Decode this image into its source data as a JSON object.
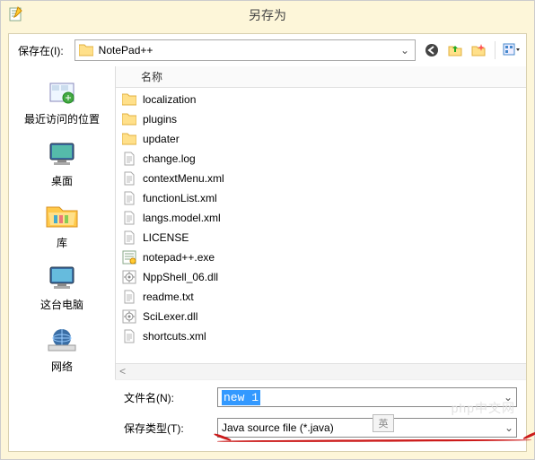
{
  "title": "另存为",
  "location": {
    "label": "保存在(I):",
    "value": "NotePad++"
  },
  "places": [
    {
      "id": "recent",
      "label": "最近访问的位置"
    },
    {
      "id": "desktop",
      "label": "桌面"
    },
    {
      "id": "libraries",
      "label": "库"
    },
    {
      "id": "thispc",
      "label": "这台电脑"
    },
    {
      "id": "network",
      "label": "网络"
    }
  ],
  "fileHeader": "名称",
  "files": [
    {
      "type": "folder",
      "name": "localization"
    },
    {
      "type": "folder",
      "name": "plugins"
    },
    {
      "type": "folder",
      "name": "updater"
    },
    {
      "type": "file",
      "name": "change.log"
    },
    {
      "type": "file",
      "name": "contextMenu.xml"
    },
    {
      "type": "file",
      "name": "functionList.xml"
    },
    {
      "type": "file",
      "name": "langs.model.xml"
    },
    {
      "type": "file",
      "name": "LICENSE"
    },
    {
      "type": "exe",
      "name": "notepad++.exe"
    },
    {
      "type": "dll",
      "name": "NppShell_06.dll"
    },
    {
      "type": "file",
      "name": "readme.txt"
    },
    {
      "type": "dll",
      "name": "SciLexer.dll"
    },
    {
      "type": "file",
      "name": "shortcuts.xml"
    }
  ],
  "filename": {
    "label": "文件名(N):",
    "value": "new 1"
  },
  "filetype": {
    "label": "保存类型(T):",
    "value": "Java source file (*.java)"
  },
  "langBadge": "英",
  "watermark": "php中文网"
}
